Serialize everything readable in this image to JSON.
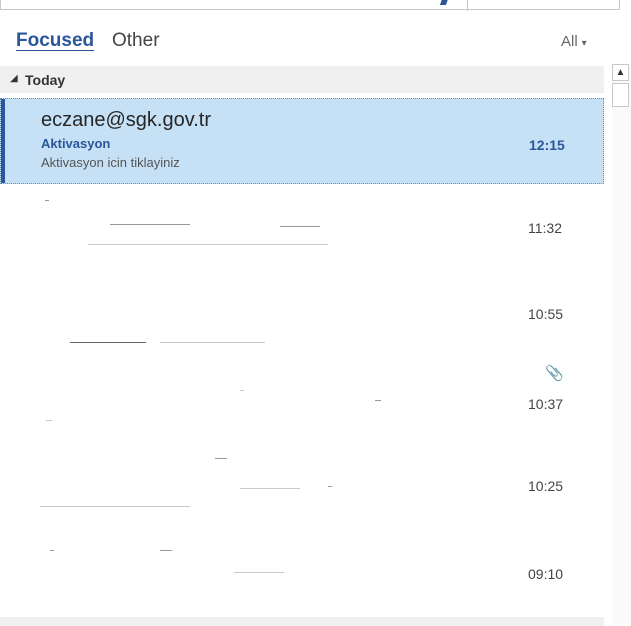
{
  "filter_tabs": {
    "focused": "Focused",
    "other": "Other",
    "filter": "All",
    "filter_caret": "▾"
  },
  "group": {
    "toggle": "◢",
    "label": "Today"
  },
  "selected_message": {
    "sender": "eczane@sgk.gov.tr",
    "subject": "Aktivasyon",
    "preview": "Aktivasyon icin tiklayiniz",
    "time": "12:15"
  },
  "messages": [
    {
      "time": "11:32"
    },
    {
      "time": "10:55"
    },
    {
      "time": "10:37",
      "attachment_icon": "paperclip-icon"
    },
    {
      "time": "10:25"
    },
    {
      "time": "09:10"
    }
  ],
  "scrollbar": {
    "up_arrow": "▲"
  },
  "colors": {
    "accent": "#2b579a",
    "selected_bg": "#c6e1f6",
    "group_bg": "#f0f0f0"
  }
}
